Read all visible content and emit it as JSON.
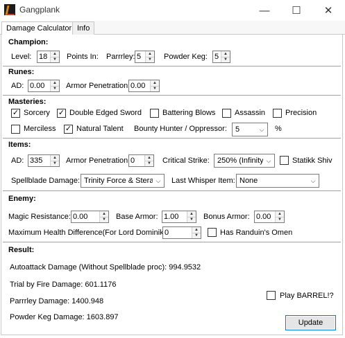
{
  "window": {
    "title": "Gangplank",
    "minimize": "—",
    "maximize": "☐",
    "close": "✕"
  },
  "tabs": [
    "Damage Calculator",
    "Info"
  ],
  "champion": {
    "heading": "Champion:",
    "level_label": "Level:",
    "level_value": "18",
    "points_label": "Points In:",
    "parrrley_label": "Parrrley:",
    "parrrley_value": "5",
    "powder_label": "Powder Keg:",
    "powder_value": "5"
  },
  "runes": {
    "heading": "Runes:",
    "ad_label": "AD:",
    "ad_value": "0.00",
    "arpen_label": "Armor Penetration:",
    "arpen_value": "0.00"
  },
  "masteries": {
    "heading": "Masteries:",
    "sorcery": {
      "label": "Sorcery",
      "checked": "✓"
    },
    "double_edged": {
      "label": "Double Edged Sword",
      "checked": "✓"
    },
    "battering": {
      "label": "Battering Blows",
      "checked": ""
    },
    "assassin": {
      "label": "Assassin",
      "checked": ""
    },
    "precision": {
      "label": "Precision",
      "checked": ""
    },
    "merciless": {
      "label": "Merciless",
      "checked": ""
    },
    "natural_talent": {
      "label": "Natural Talent",
      "checked": "✓"
    },
    "bounty_label": "Bounty Hunter / Oppressor:",
    "bounty_value": "5",
    "percent": "%"
  },
  "items": {
    "heading": "Items:",
    "ad_label": "AD:",
    "ad_value": "335",
    "arpen_label": "Armor Penetration:",
    "arpen_value": "0",
    "crit_label": "Critical Strike:",
    "crit_value": "250% (Infinity",
    "statikk": {
      "label": "Statikk Shiv",
      "checked": ""
    },
    "spellblade_label": "Spellblade Damage:",
    "spellblade_value": "Trinity Force & Steral",
    "whisper_label": "Last Whisper Item:",
    "whisper_value": "None"
  },
  "enemy": {
    "heading": "Enemy:",
    "mr_label": "Magic Resistance:",
    "mr_value": "0.00",
    "base_armor_label": "Base Armor:",
    "base_armor_value": "1.00",
    "bonus_armor_label": "Bonus Armor:",
    "bonus_armor_value": "0.00",
    "maxhp_label": "Maximum Health Difference(For Lord Dominik's",
    "maxhp_value": "0",
    "randuin": {
      "label": "Has Randuin's Omen",
      "checked": ""
    }
  },
  "result": {
    "heading": "Result:",
    "autoattack": "Autoattack Damage (Without Spellblade proc): 994.9532",
    "trial": "Trial by Fire Damage: 601.1176",
    "parrrley": "Parrrley Damage: 1400.948",
    "powder": "Powder Keg Damage: 1603.897",
    "barrel": {
      "label": "Play BARREL!?",
      "checked": ""
    },
    "update_label": "Update"
  }
}
